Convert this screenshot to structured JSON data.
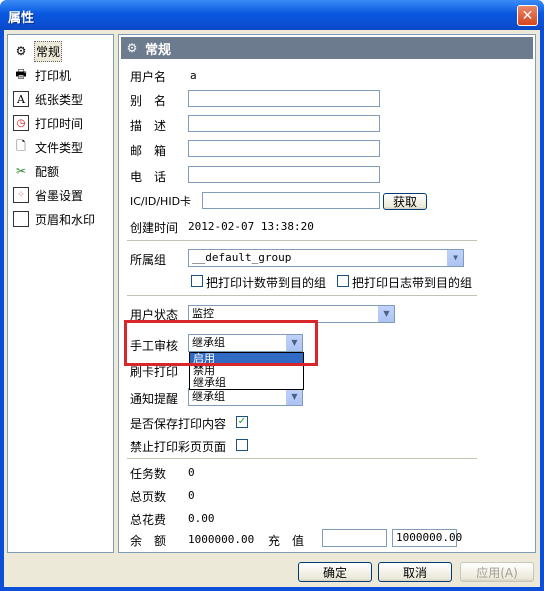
{
  "window": {
    "title": "属性",
    "close_glyph": "✕"
  },
  "nav": {
    "items": [
      {
        "label": "常规",
        "icon": "gear-icon"
      },
      {
        "label": "打印机",
        "icon": "printer-icon"
      },
      {
        "label": "纸张类型",
        "icon": "paper-a-icon"
      },
      {
        "label": "打印时间",
        "icon": "clock-icon"
      },
      {
        "label": "文件类型",
        "icon": "document-icon"
      },
      {
        "label": "配额",
        "icon": "quota-icon"
      },
      {
        "label": "省墨设置",
        "icon": "ink-dots-icon"
      },
      {
        "label": "页眉和水印",
        "icon": "page-icon"
      }
    ]
  },
  "panel": {
    "header": "常规",
    "username_label": "用户名",
    "username_value": "a",
    "alias_label": "别　名",
    "desc_label": "描　述",
    "email_label": "邮　箱",
    "phone_label": "电　话",
    "card_label": "IC/ID/HID卡",
    "get_button": "获取",
    "created_label": "创建时间",
    "created_value": "2012-02-07 13:38:20",
    "group_label": "所属组",
    "group_value": "__default_group",
    "chk_print_count": "把打印计数带到目的组",
    "chk_print_log": "把打印日志带到目的组",
    "user_status_label": "用户状态",
    "user_status_value": "监控",
    "manual_review_label": "手工审核",
    "manual_review_value": "继承组",
    "swipe_print_label": "刷卡打印",
    "notify_label": "通知提醒",
    "notify_value": "继承组",
    "save_content_label": "是否保存打印内容",
    "disable_color_label": "禁止打印彩页页面",
    "task_count_label": "任务数",
    "task_count_value": "0",
    "total_pages_label": "总页数",
    "total_pages_value": "0",
    "total_cost_label": "总花费",
    "total_cost_value": "0.00",
    "balance_label": "余　额",
    "balance_value": "1000000.00",
    "recharge_label": "充　值",
    "recharge_result": "1000000.00",
    "dropdown_options": [
      "启用",
      "禁用",
      "继承组"
    ]
  },
  "footer": {
    "ok": "确定",
    "cancel": "取消",
    "apply": "应用(A)"
  },
  "colors": {
    "accent": "#0a58e0",
    "highlight": "#316ac5",
    "annotation": "#d9262b"
  }
}
